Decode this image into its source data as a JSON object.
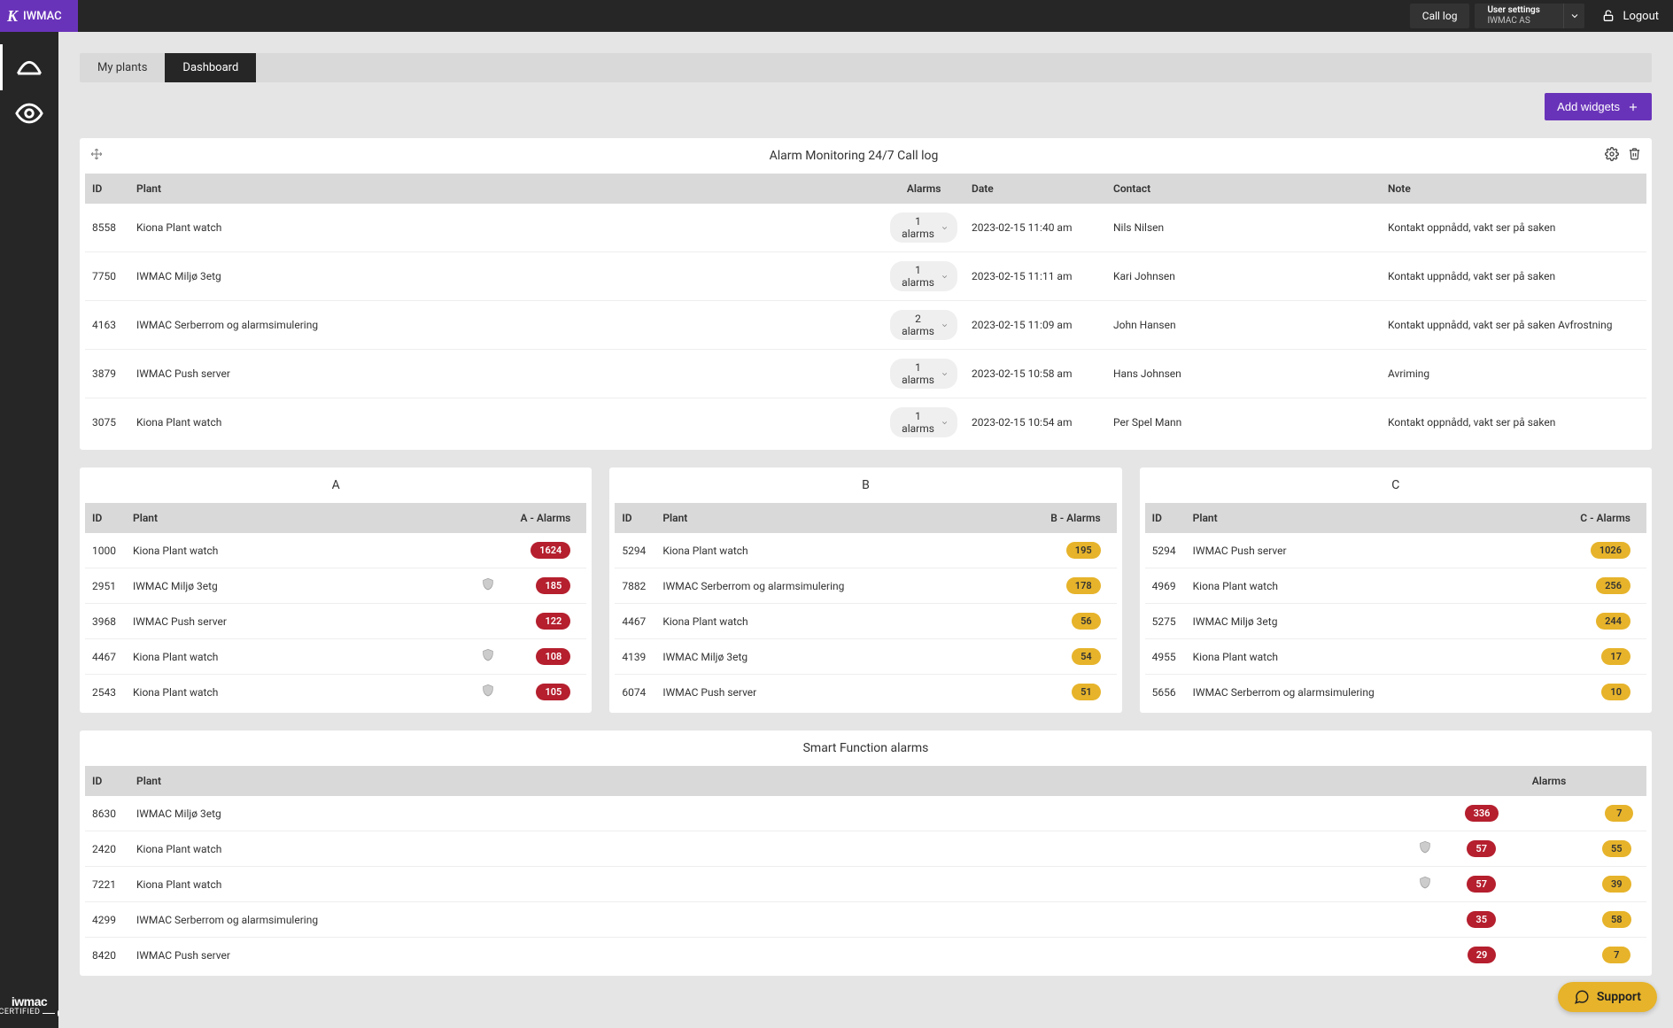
{
  "brand": "IWMAC",
  "topbar": {
    "call_log": "Call log",
    "user_settings_label": "User settings",
    "user_org": "IWMAC AS",
    "logout": "Logout"
  },
  "tabs": {
    "my_plants": "My plants",
    "dashboard": "Dashboard"
  },
  "add_widgets": "Add widgets",
  "call_log_widget": {
    "title": "Alarm Monitoring 24/7 Call log",
    "headers": {
      "id": "ID",
      "plant": "Plant",
      "alarms": "Alarms",
      "date": "Date",
      "contact": "Contact",
      "note": "Note"
    },
    "rows": [
      {
        "id": "8558",
        "plant": "Kiona Plant watch",
        "alarms": "1 alarms",
        "date": "2023-02-15 11:40 am",
        "contact": "Nils Nilsen",
        "note": "Kontakt oppnådd, vakt ser på saken"
      },
      {
        "id": "7750",
        "plant": "IWMAC Miljø 3etg",
        "alarms": "1 alarms",
        "date": "2023-02-15 11:11 am",
        "contact": "Kari Johnsen",
        "note": "Kontakt uppnådd, vakt ser på saken"
      },
      {
        "id": "4163",
        "plant": "IWMAC Serberrom og alarmsimulering",
        "alarms": "2 alarms",
        "date": "2023-02-15 11:09 am",
        "contact": "John Hansen",
        "note": "Kontakt uppnådd, vakt ser på saken Avfrostning"
      },
      {
        "id": "3879",
        "plant": "IWMAC Push server",
        "alarms": "1 alarms",
        "date": "2023-02-15 10:58 am",
        "contact": "Hans Johnsen",
        "note": "Avriming"
      },
      {
        "id": "3075",
        "plant": "Kiona Plant watch",
        "alarms": "1 alarms",
        "date": "2023-02-15 10:54 am",
        "contact": "Per Spel Mann",
        "note": "Kontakt oppnådd, vakt ser på saken"
      }
    ]
  },
  "mini": {
    "a": {
      "title": "A",
      "headers": {
        "id": "ID",
        "plant": "Plant",
        "alarms": "A - Alarms"
      },
      "rows": [
        {
          "id": "1000",
          "plant": "Kiona Plant watch",
          "shield": false,
          "count": "1624"
        },
        {
          "id": "2951",
          "plant": "IWMAC Miljø 3etg",
          "shield": true,
          "count": "185"
        },
        {
          "id": "3968",
          "plant": "IWMAC Push server",
          "shield": false,
          "count": "122"
        },
        {
          "id": "4467",
          "plant": "Kiona Plant watch",
          "shield": true,
          "count": "108"
        },
        {
          "id": "2543",
          "plant": "Kiona Plant watch",
          "shield": true,
          "count": "105"
        }
      ]
    },
    "b": {
      "title": "B",
      "headers": {
        "id": "ID",
        "plant": "Plant",
        "alarms": "B - Alarms"
      },
      "rows": [
        {
          "id": "5294",
          "plant": "Kiona Plant watch",
          "count": "195"
        },
        {
          "id": "7882",
          "plant": "IWMAC Serberrom og alarmsimulering",
          "count": "178"
        },
        {
          "id": "4467",
          "plant": "Kiona Plant watch",
          "count": "56"
        },
        {
          "id": "4139",
          "plant": "IWMAC Miljø 3etg",
          "count": "54"
        },
        {
          "id": "6074",
          "plant": "IWMAC Push server",
          "count": "51"
        }
      ]
    },
    "c": {
      "title": "C",
      "headers": {
        "id": "ID",
        "plant": "Plant",
        "alarms": "C - Alarms"
      },
      "rows": [
        {
          "id": "5294",
          "plant": "IWMAC Push server",
          "count": "1026"
        },
        {
          "id": "4969",
          "plant": "Kiona Plant watch",
          "count": "256"
        },
        {
          "id": "5275",
          "plant": "IWMAC Miljø 3etg",
          "count": "244"
        },
        {
          "id": "4955",
          "plant": "Kiona Plant watch",
          "count": "17"
        },
        {
          "id": "5656",
          "plant": "IWMAC Serberrom og alarmsimulering",
          "count": "10"
        }
      ]
    }
  },
  "smart": {
    "title": "Smart Function alarms",
    "headers": {
      "id": "ID",
      "plant": "Plant",
      "alarms": "Alarms"
    },
    "rows": [
      {
        "id": "8630",
        "plant": "IWMAC Miljø 3etg",
        "shield": false,
        "red": "336",
        "amber": "7"
      },
      {
        "id": "2420",
        "plant": "Kiona Plant watch",
        "shield": true,
        "red": "57",
        "amber": "55"
      },
      {
        "id": "7221",
        "plant": "Kiona Plant watch",
        "shield": true,
        "red": "57",
        "amber": "39"
      },
      {
        "id": "4299",
        "plant": "IWMAC Serberrom og alarmsimulering",
        "shield": false,
        "red": "35",
        "amber": "58"
      },
      {
        "id": "8420",
        "plant": "IWMAC Push server",
        "shield": false,
        "red": "29",
        "amber": "7"
      }
    ]
  },
  "support": "Support",
  "footer_logo": {
    "brand": "iwmac",
    "sub": "CERTIFIED"
  }
}
